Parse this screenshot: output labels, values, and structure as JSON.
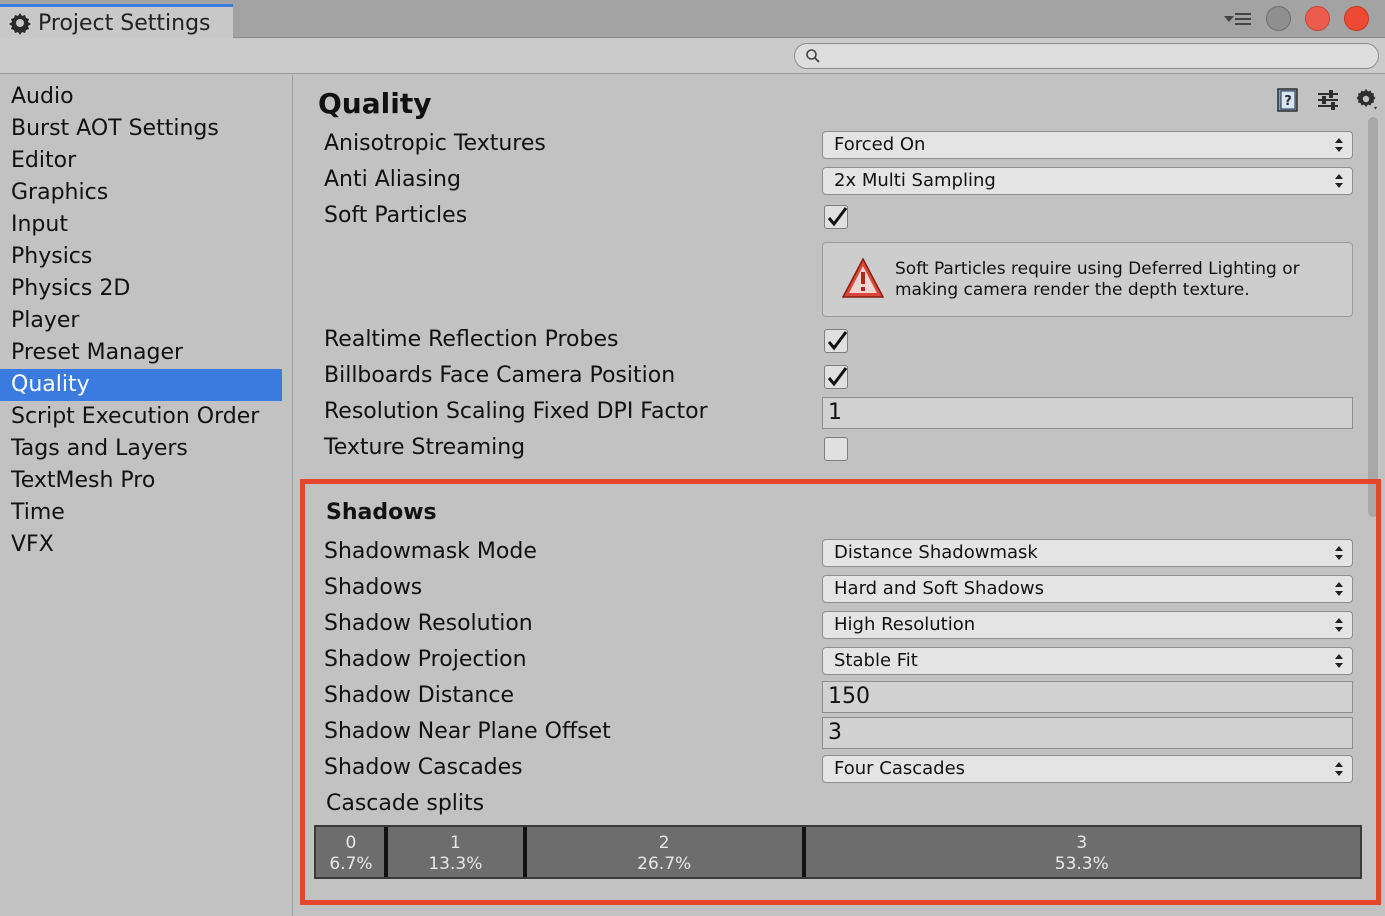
{
  "window": {
    "tab_title": "Project Settings",
    "tab_icon": "gear-icon",
    "controls": [
      "menu-icon",
      "minimize-button",
      "maximize-button",
      "close-button"
    ]
  },
  "search": {
    "value": "",
    "placeholder": ""
  },
  "sidebar": {
    "items": [
      {
        "label": "Audio"
      },
      {
        "label": "Burst AOT Settings"
      },
      {
        "label": "Editor"
      },
      {
        "label": "Graphics"
      },
      {
        "label": "Input"
      },
      {
        "label": "Physics"
      },
      {
        "label": "Physics 2D"
      },
      {
        "label": "Player"
      },
      {
        "label": "Preset Manager"
      },
      {
        "label": "Quality"
      },
      {
        "label": "Script Execution Order"
      },
      {
        "label": "Tags and Layers"
      },
      {
        "label": "TextMesh Pro"
      },
      {
        "label": "Time"
      },
      {
        "label": "VFX"
      }
    ],
    "selected": "Quality"
  },
  "main": {
    "title": "Quality",
    "tools": [
      "help-book-icon",
      "presets-sliders-icon",
      "settings-gear-icon"
    ],
    "rendering": {
      "anisotropic_textures": {
        "label": "Anisotropic Textures",
        "value": "Forced On"
      },
      "anti_aliasing": {
        "label": "Anti Aliasing",
        "value": "2x Multi Sampling"
      },
      "soft_particles": {
        "label": "Soft Particles",
        "checked": true
      },
      "soft_particles_warning": "Soft Particles require using Deferred Lighting or making camera render the depth texture.",
      "realtime_reflection_probes": {
        "label": "Realtime Reflection Probes",
        "checked": true
      },
      "billboards_face_camera": {
        "label": "Billboards Face Camera Position",
        "checked": true
      },
      "resolution_scaling": {
        "label": "Resolution Scaling Fixed DPI Factor",
        "value": "1"
      },
      "texture_streaming": {
        "label": "Texture Streaming",
        "checked": false
      }
    },
    "shadows": {
      "section_title": "Shadows",
      "shadowmask_mode": {
        "label": "Shadowmask Mode",
        "value": "Distance Shadowmask"
      },
      "shadows": {
        "label": "Shadows",
        "value": "Hard and Soft Shadows"
      },
      "shadow_resolution": {
        "label": "Shadow Resolution",
        "value": "High Resolution"
      },
      "shadow_projection": {
        "label": "Shadow Projection",
        "value": "Stable Fit"
      },
      "shadow_distance": {
        "label": "Shadow Distance",
        "value": "150"
      },
      "shadow_near_plane_offset": {
        "label": "Shadow Near Plane Offset",
        "value": "3"
      },
      "shadow_cascades": {
        "label": "Shadow Cascades",
        "value": "Four Cascades"
      },
      "cascade_splits_label": "Cascade splits",
      "cascade_splits": [
        {
          "index": "0",
          "percent": "6.7%",
          "fraction": 0.067
        },
        {
          "index": "1",
          "percent": "13.3%",
          "fraction": 0.133
        },
        {
          "index": "2",
          "percent": "26.7%",
          "fraction": 0.267
        },
        {
          "index": "3",
          "percent": "53.3%",
          "fraction": 0.533
        }
      ]
    }
  },
  "colors": {
    "selection": "#3b7be0",
    "highlight_border": "#e6452d",
    "window_close": "#ec4a33"
  }
}
